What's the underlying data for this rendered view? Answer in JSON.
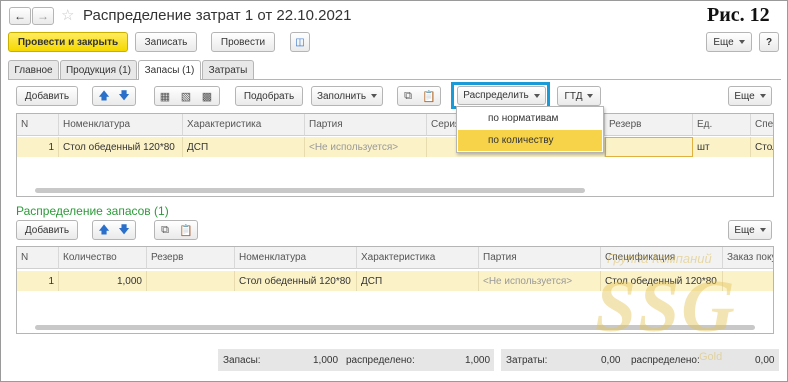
{
  "title_bar": {
    "title": "Распределение затрат 1 от 22.10.2021",
    "figure_label": "Рис. 12"
  },
  "toolbar": {
    "post_close": "Провести и закрыть",
    "save": "Записать",
    "post": "Провести",
    "more": "Еще",
    "help": "?"
  },
  "tabs": [
    {
      "label": "Главное"
    },
    {
      "label": "Продукция (1)"
    },
    {
      "label": "Запасы (1)"
    },
    {
      "label": "Затраты"
    }
  ],
  "stock_toolbar": {
    "add": "Добавить",
    "pick": "Подобрать",
    "fill": "Заполнить",
    "distribute": "Распределить",
    "gtd": "ГТД",
    "more": "Еще"
  },
  "distribute_menu": {
    "items": [
      "по нормативам",
      "по количеству"
    ],
    "selected": "по количеству"
  },
  "stock_table": {
    "columns": [
      "N",
      "Номенклатура",
      "Характеристика",
      "Партия",
      "Серия",
      "Резерв",
      "Ед.",
      "Спец"
    ],
    "row": {
      "n": "1",
      "nomenclature": "Стол обеденный 120*80",
      "characteristic": "ДСП",
      "batch": "<Не используется>",
      "series": "",
      "reserve": "",
      "unit": "шт",
      "spec": "Стол"
    }
  },
  "distribution": {
    "heading": "Распределение запасов (1)",
    "add": "Добавить",
    "more": "Еще",
    "columns": [
      "N",
      "Количество",
      "Резерв",
      "Номенклатура",
      "Характеристика",
      "Партия",
      "Спецификация",
      "Заказ поку"
    ],
    "row": {
      "n": "1",
      "quantity": "1,000",
      "reserve": "",
      "nomenclature": "Стол обеденный 120*80",
      "characteristic": "ДСП",
      "batch": "<Не используется>",
      "spec": "Стол обеденный 120*80",
      "order": ""
    }
  },
  "totals": {
    "stock_label": "Запасы:",
    "stock_value": "1,000",
    "distributed_label": "распределено:",
    "distributed_value": "1,000",
    "costs_label": "Затраты:",
    "costs_value": "0,00",
    "costs_distributed_label": "распределено:",
    "costs_distributed_value": "0,00"
  },
  "watermark": {
    "brand": "SSG",
    "line1": "Группа Компаний",
    "line2": "Gold"
  },
  "colors": {
    "accent": "#1a9ad6",
    "highlight_row": "#fbf2c8",
    "menu_selected": "#f7d34a",
    "section_heading": "#2d9a3a"
  }
}
